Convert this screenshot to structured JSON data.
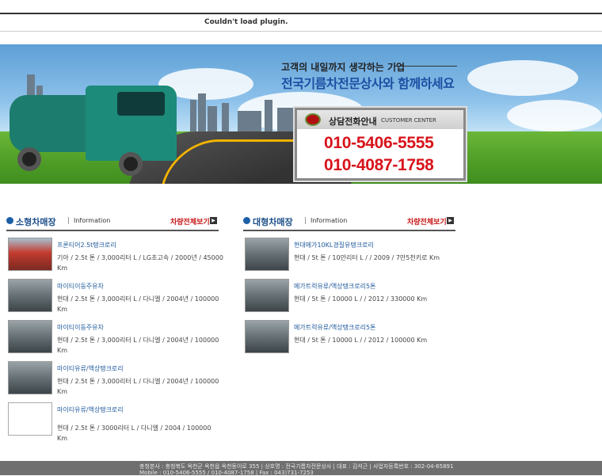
{
  "plugin": {
    "message": "Couldn't load plugin."
  },
  "banner": {
    "slogan_small": "고객의 내일까지 생각하는 기업",
    "slogan_large": "전국기름차전문상사와 함께하세요",
    "call": {
      "title": "상담전화안내",
      "subtitle": "CUSTOMER CENTER",
      "phones": [
        "010-5406-5555",
        "010-4087-1758"
      ]
    }
  },
  "small_section": {
    "title": "소형차매장",
    "info": "Information",
    "more": "차량전체보기",
    "items": [
      {
        "title": "프론티어2.5t탱크로리",
        "desc": "기아 / 2.5t 톤 / 3,000리터 L / LG초고속 / 2000년 / 45000 Km",
        "thumb": "red"
      },
      {
        "title": "마이티이동주유차",
        "desc": "현대 / 2.5t 톤 / 3,000리터 L / 다니엘 / 2004년 / 100000 Km",
        "thumb": "gray"
      },
      {
        "title": "마이티이동주유차",
        "desc": "현대 / 2.5t 톤 / 3,000리터 L / 다니엘 / 2004년 / 100000 Km",
        "thumb": "gray"
      },
      {
        "title": "마이티유류/액상탱크로리",
        "desc": "현대 / 2.5t 톤 / 3,000리터 L / 다니엘 / 2004년 / 100000 Km",
        "thumb": "gray"
      },
      {
        "title": "마이티유류/액상탱크로리",
        "desc": "현대 / 2.5t 톤 / 3000리터 L / 다니엘 / 2004 / 100000 Km",
        "thumb": "blank"
      }
    ]
  },
  "large_section": {
    "title": "대형차매장",
    "info": "Information",
    "more": "차량전체보기",
    "items": [
      {
        "title": "현대메가10KL경질유탱크로리",
        "desc": "현대 / 5t 톤 / 10만리터 L / / 2009 / 7만5천키로 Km"
      },
      {
        "title": "메가트럭유류/액상탱크로리5톤",
        "desc": "현대 / 5t 톤 / 10000 L / / 2012 / 330000 Km"
      },
      {
        "title": "메가트럭유류/액상탱크로리5톤",
        "desc": "현대 / 5t 톤 / 10000 L / / 2012 / 100000 Km"
      }
    ]
  },
  "footer": {
    "text1": "충청본사 : 충청북도 옥천군 옥천읍 옥천동이로 355 | 상호명 : 전국기름차전문상사 | 대표 : 김석근 | 사업자등록번호 : 302-04-65891",
    "text2": "Mobile : 010-5406-5555 / 010-4087-1758 | Fax : 043)731-7253"
  }
}
